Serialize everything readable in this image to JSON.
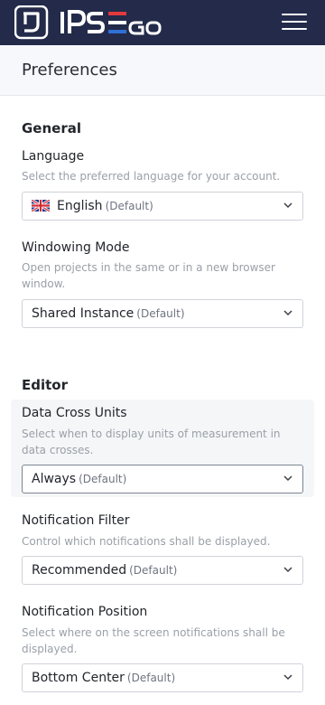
{
  "topbar": {
    "logo_text": "IPSEGO",
    "menu_icon": "hamburger-menu-icon"
  },
  "page": {
    "title": "Preferences"
  },
  "sections": {
    "general": {
      "title": "General",
      "language": {
        "label": "Language",
        "description": "Select the preferred language for your account.",
        "value": "English",
        "default_note": "(Default)",
        "icon": "uk-flag-icon"
      },
      "windowing_mode": {
        "label": "Windowing Mode",
        "description": "Open projects in the same or in a new browser window.",
        "value": "Shared Instance",
        "default_note": "(Default)"
      }
    },
    "editor": {
      "title": "Editor",
      "data_cross_units": {
        "label": "Data Cross Units",
        "description": "Select when to display units of measurement in data crosses.",
        "value": "Always",
        "default_note": "(Default)"
      },
      "notification_filter": {
        "label": "Notification Filter",
        "description": "Control which notifications shall be displayed.",
        "value": "Recommended",
        "default_note": "(Default)"
      },
      "notification_position": {
        "label": "Notification Position",
        "description": "Select where on the screen notifications shall be displayed.",
        "value": "Bottom Center",
        "default_note": "(Default)"
      }
    }
  },
  "colors": {
    "topbar_bg": "#232a4a",
    "logo_red": "#e03a3e",
    "logo_blue": "#2f6fd6",
    "page_header_bg": "#f6f8fb",
    "muted_text": "#9aa0a8"
  }
}
